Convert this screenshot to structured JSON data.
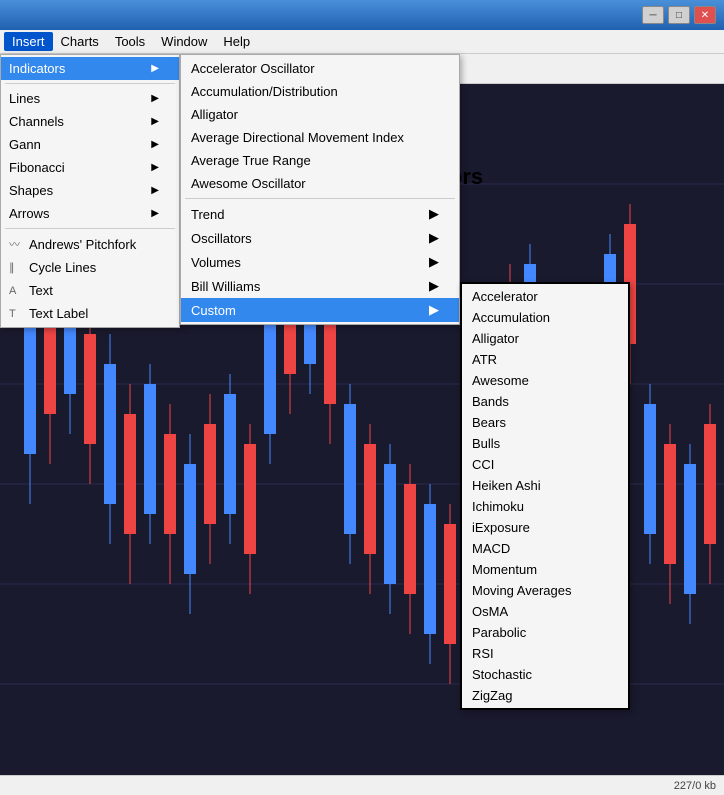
{
  "titlebar": {
    "title": "",
    "minimize": "─",
    "maximize": "□",
    "close": "✕"
  },
  "menubar": {
    "items": [
      "Insert",
      "Charts",
      "Tools",
      "Window",
      "Help"
    ]
  },
  "menu_insert": {
    "active_item": "Indicators",
    "items": [
      {
        "label": "Indicators",
        "has_arrow": true,
        "icon": ""
      },
      {
        "sep": true
      },
      {
        "label": "Lines",
        "has_arrow": true,
        "icon": ""
      },
      {
        "label": "Channels",
        "has_arrow": true,
        "icon": ""
      },
      {
        "label": "Gann",
        "has_arrow": true,
        "icon": ""
      },
      {
        "label": "Fibonacci",
        "has_arrow": true,
        "icon": ""
      },
      {
        "label": "Shapes",
        "has_arrow": true,
        "icon": ""
      },
      {
        "label": "Arrows",
        "has_arrow": true,
        "icon": ""
      },
      {
        "sep": true
      },
      {
        "label": "Andrews' Pitchfork",
        "has_arrow": false,
        "icon": "〰"
      },
      {
        "label": "Cycle Lines",
        "has_arrow": false,
        "icon": "∥"
      },
      {
        "label": "Text",
        "has_arrow": false,
        "icon": "A"
      },
      {
        "label": "Text Label",
        "has_arrow": false,
        "icon": "T"
      }
    ]
  },
  "menu_indicators": {
    "items": [
      {
        "label": "Accelerator Oscillator",
        "has_arrow": false
      },
      {
        "label": "Accumulation/Distribution",
        "has_arrow": false
      },
      {
        "label": "Alligator",
        "has_arrow": false
      },
      {
        "label": "Average Directional Movement Index",
        "has_arrow": false
      },
      {
        "label": "Average True Range",
        "has_arrow": false
      },
      {
        "label": "Awesome Oscillator",
        "has_arrow": false
      },
      {
        "sep": true
      },
      {
        "label": "Trend",
        "has_arrow": true
      },
      {
        "label": "Oscillators",
        "has_arrow": true
      },
      {
        "label": "Volumes",
        "has_arrow": true
      },
      {
        "label": "Bill Williams",
        "has_arrow": true
      },
      {
        "label": "Custom",
        "has_arrow": true,
        "active": true
      }
    ]
  },
  "menu_custom": {
    "items": [
      "Accelerator",
      "Accumulation",
      "Alligator",
      "ATR",
      "Awesome",
      "Bands",
      "Bears",
      "Bulls",
      "CCI",
      "Heiken Ashi",
      "Ichimoku",
      "iExposure",
      "MACD",
      "Momentum",
      "Moving Averages",
      "OsMA",
      "Parabolic",
      "RSI",
      "Stochastic",
      "ZigZag"
    ]
  },
  "custom_label": "Custom Indicators",
  "status": {
    "text": "227/0 kb"
  }
}
